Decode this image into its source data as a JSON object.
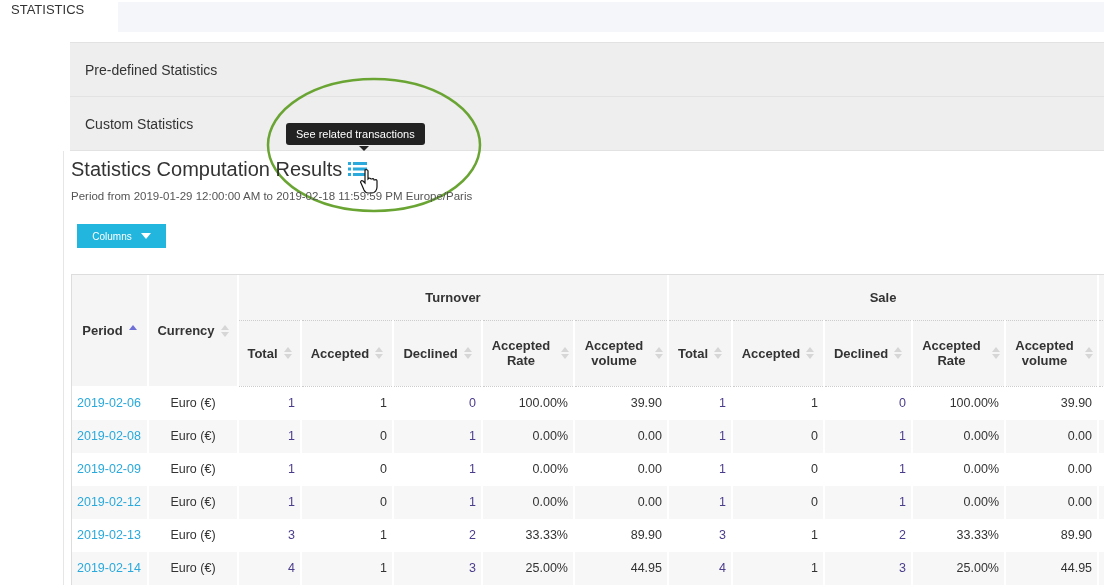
{
  "page_title": "STATISTICS",
  "accordion": [
    {
      "label": "Pre-defined Statistics"
    },
    {
      "label": "Custom Statistics"
    }
  ],
  "results": {
    "title": "Statistics Computation Results",
    "tooltip": "See related transactions",
    "period": "Period from 2019-01-29 12:00:00 AM to 2019-02-18 11:59:59 PM Europe/Paris",
    "columns_button": "Columns",
    "table": {
      "key_columns": [
        {
          "label": "Period",
          "sorted": true
        },
        {
          "label": "Currency",
          "sorted": false
        }
      ],
      "groups": [
        {
          "label": "Turnover",
          "columns": [
            {
              "label": "Total",
              "sorted": false,
              "link": true
            },
            {
              "label": "Accepted",
              "sorted": false,
              "link": false
            },
            {
              "label": "Declined",
              "sorted": false,
              "link": true
            },
            {
              "label": "Accepted Rate",
              "sorted": false,
              "link": false
            },
            {
              "label": "Accepted volume",
              "sorted": false,
              "link": false
            }
          ]
        },
        {
          "label": "Sale",
          "columns": [
            {
              "label": "Total",
              "sorted": false,
              "link": true
            },
            {
              "label": "Accepted",
              "sorted": false,
              "link": false
            },
            {
              "label": "Declined",
              "sorted": false,
              "link": true
            },
            {
              "label": "Accepted Rate",
              "sorted": false,
              "link": false
            },
            {
              "label": "Accepted volume",
              "sorted": false,
              "link": false
            }
          ]
        }
      ],
      "rows": [
        {
          "period": "2019-02-06",
          "currency": "Euro (€)",
          "values": [
            "1",
            "1",
            "0",
            "100.00%",
            "39.90",
            "1",
            "1",
            "0",
            "100.00%",
            "39.90"
          ]
        },
        {
          "period": "2019-02-08",
          "currency": "Euro (€)",
          "values": [
            "1",
            "0",
            "1",
            "0.00%",
            "0.00",
            "1",
            "0",
            "1",
            "0.00%",
            "0.00"
          ]
        },
        {
          "period": "2019-02-09",
          "currency": "Euro (€)",
          "values": [
            "1",
            "0",
            "1",
            "0.00%",
            "0.00",
            "1",
            "0",
            "1",
            "0.00%",
            "0.00"
          ]
        },
        {
          "period": "2019-02-12",
          "currency": "Euro (€)",
          "values": [
            "1",
            "0",
            "1",
            "0.00%",
            "0.00",
            "1",
            "0",
            "1",
            "0.00%",
            "0.00"
          ]
        },
        {
          "period": "2019-02-13",
          "currency": "Euro (€)",
          "values": [
            "3",
            "1",
            "2",
            "33.33%",
            "89.90",
            "3",
            "1",
            "2",
            "33.33%",
            "89.90"
          ]
        },
        {
          "period": "2019-02-14",
          "currency": "Euro (€)",
          "values": [
            "4",
            "1",
            "3",
            "25.00%",
            "44.95",
            "4",
            "1",
            "3",
            "25.00%",
            "44.95"
          ]
        }
      ]
    }
  }
}
